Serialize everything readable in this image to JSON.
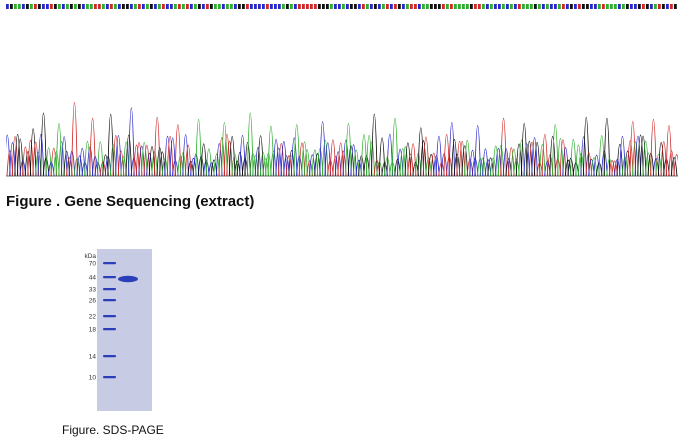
{
  "sequencing": {
    "title": "Figure . Gene Sequencing (extract)",
    "base_colors": {
      "A": "#2eae2e",
      "C": "#2828c8",
      "G": "#111111",
      "T": "#d02828"
    },
    "icon": "chromatogram-trace"
  },
  "gel": {
    "caption": "Figure. SDS-PAGE",
    "unit_label": "kDa",
    "marker_labels": [
      "70",
      "44",
      "33",
      "26",
      "22",
      "18",
      "14",
      "10"
    ],
    "band_color": "#2b3fb8",
    "gel_color": "#c8cbe4",
    "icon": "sds-page-gel"
  }
}
